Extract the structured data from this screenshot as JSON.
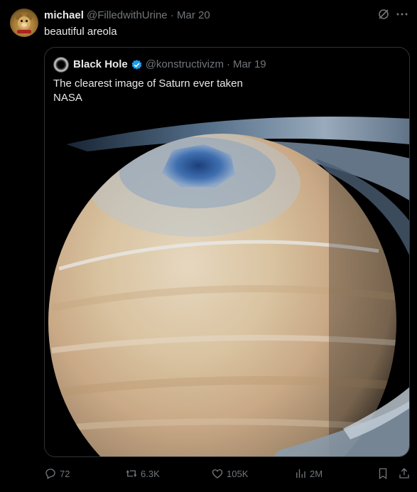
{
  "tweet": {
    "author_name": "michael",
    "author_handle": "@FilledwithUrine",
    "separator": "·",
    "date": "Mar 20",
    "text": "beautiful areola",
    "avatar_icon": "teddy-bear-avatar"
  },
  "quoted": {
    "author_name": "Black Hole",
    "author_handle": "@konstructivizm",
    "separator": "·",
    "date": "Mar 19",
    "text_line1": "The clearest image of Saturn ever taken",
    "text_line2": "NASA",
    "verified_color": "#1d9bf0",
    "media_icon": "saturn-photo"
  },
  "actions": {
    "replies": "72",
    "reposts": "6.3K",
    "likes": "105K",
    "views": "2M"
  },
  "colors": {
    "background": "#000000",
    "text": "#e7e9ea",
    "muted": "#71767b",
    "border": "#2f3336"
  }
}
